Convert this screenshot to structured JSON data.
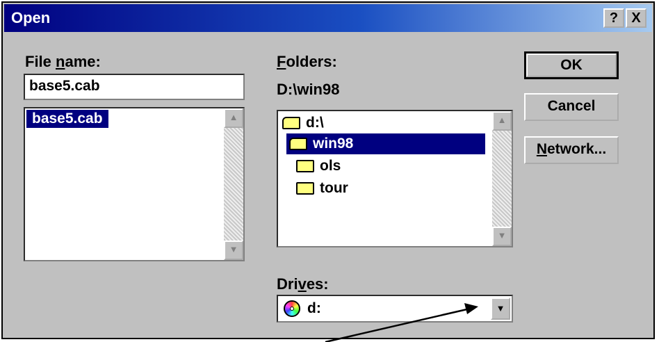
{
  "window": {
    "title": "Open",
    "help_button": "?",
    "close_button": "X"
  },
  "file_name": {
    "label_prefix": "File ",
    "label_accel": "n",
    "label_suffix": "ame:",
    "value": "base5.cab",
    "list": [
      "base5.cab"
    ]
  },
  "folders": {
    "label_accel": "F",
    "label_suffix": "olders:",
    "current_path": "D:\\win98",
    "items": [
      {
        "name": "d:\\",
        "icon": "open-folder-icon",
        "selected": false
      },
      {
        "name": "win98",
        "icon": "open-folder-icon",
        "selected": true
      },
      {
        "name": "ols",
        "icon": "folder-icon",
        "selected": false
      },
      {
        "name": "tour",
        "icon": "folder-icon",
        "selected": false
      }
    ]
  },
  "drives": {
    "label_prefix": "Dri",
    "label_accel": "v",
    "label_suffix": "es:",
    "selected": "d:",
    "icon": "cd-drive-icon"
  },
  "buttons": {
    "ok": "OK",
    "cancel": "Cancel",
    "network_accel": "N",
    "network_suffix": "etwork..."
  },
  "scroll_arrows": {
    "up": "▲",
    "down": "▼"
  },
  "colors": {
    "title_bar": "#000080",
    "selection": "#000080",
    "face": "#c0c0c0"
  }
}
